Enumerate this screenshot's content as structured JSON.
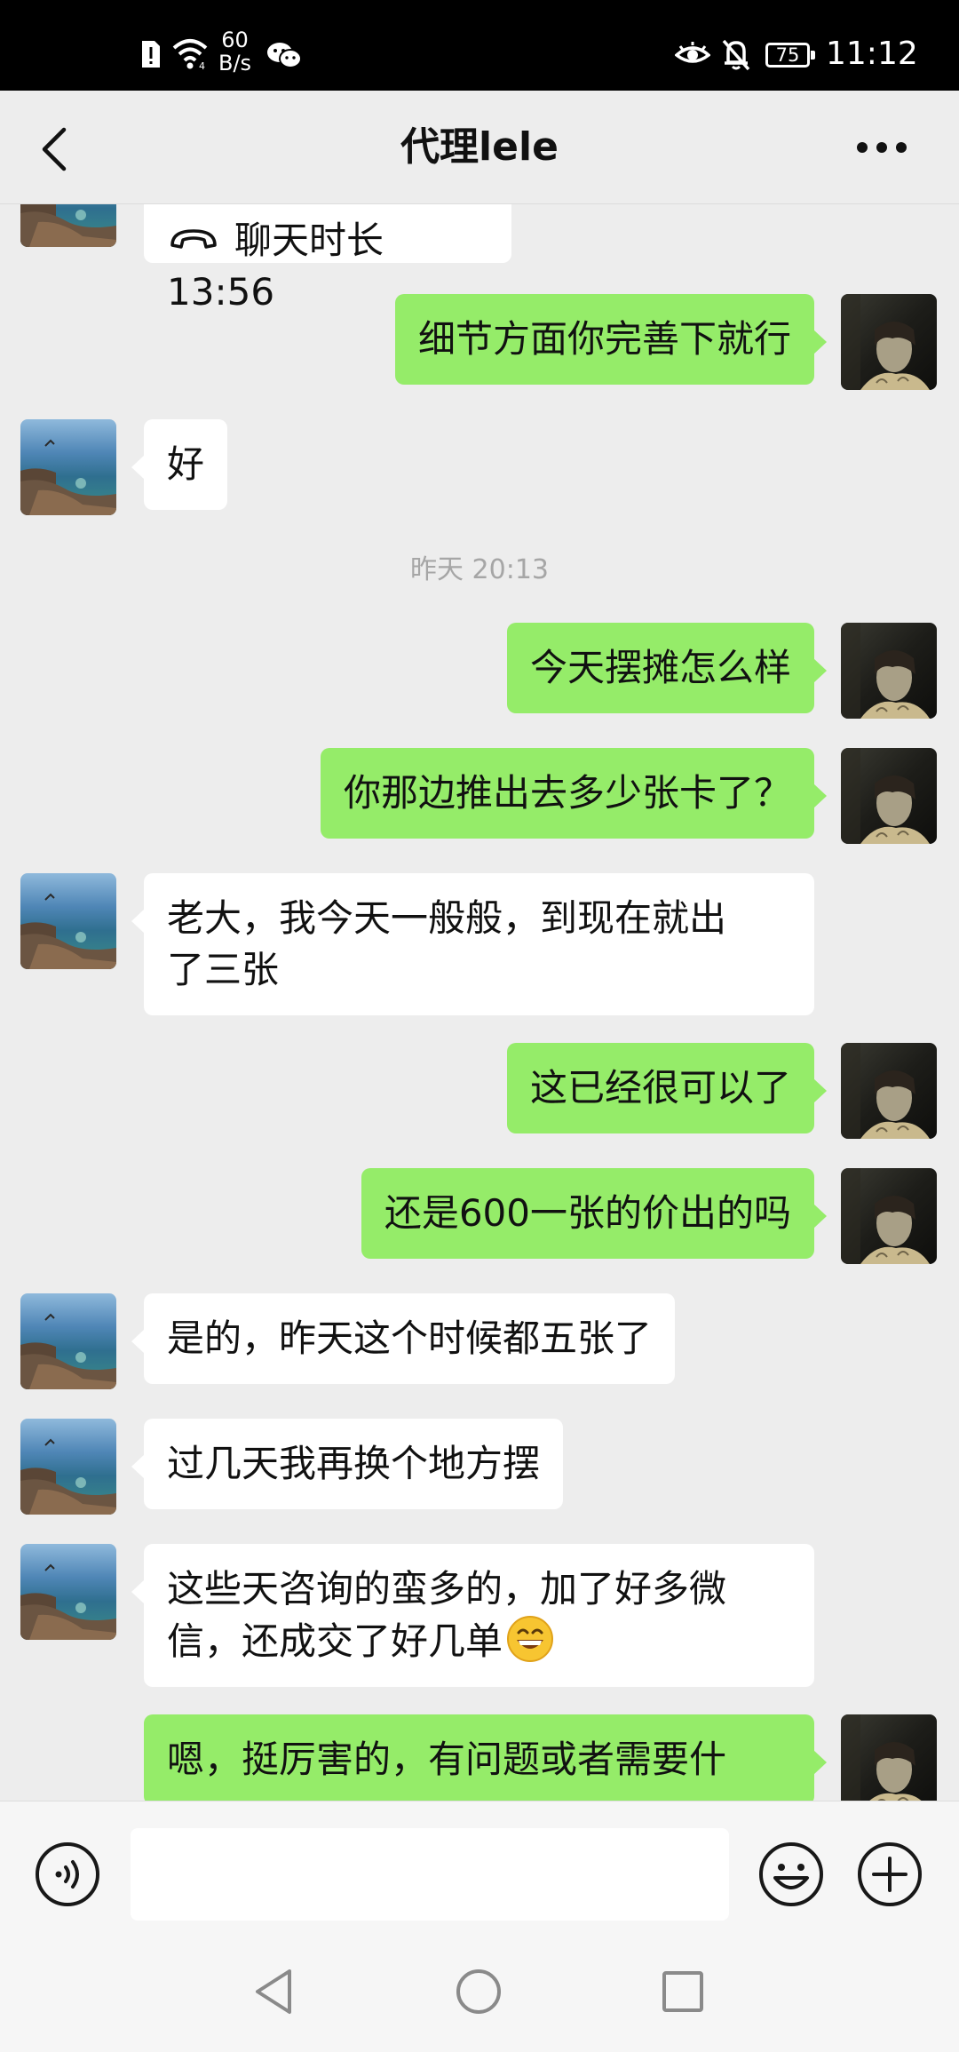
{
  "status_bar": {
    "net_speed_value": "60",
    "net_speed_unit": "B/s",
    "battery": "75",
    "time": "11:12",
    "icons": [
      "sim-alert-icon",
      "wifi-icon",
      "wechat-notification-icon",
      "eye-comfort-icon",
      "mute-bell-icon",
      "battery-icon"
    ]
  },
  "header": {
    "back_icon": "chevron-left-icon",
    "title": "代理lele",
    "more_icon": "more-dots-icon"
  },
  "messages": [
    {
      "side": "them",
      "type": "call",
      "icon": "phone-icon",
      "text": "聊天时长 13:56",
      "partial": true
    },
    {
      "side": "me",
      "text": "细节方面你完善下就行"
    },
    {
      "side": "them",
      "text": "好"
    },
    {
      "type": "timestamp",
      "text": "昨天 20:13"
    },
    {
      "side": "me",
      "text": "今天摆摊怎么样"
    },
    {
      "side": "me",
      "text": "你那边推出去多少张卡了？"
    },
    {
      "side": "them",
      "line1": "老大，我今天一般般，到现在就出",
      "line2": "了三张"
    },
    {
      "side": "me",
      "text": "这已经很可以了"
    },
    {
      "side": "me",
      "text": "还是600一张的价出的吗"
    },
    {
      "side": "them",
      "text": "是的，昨天这个时候都五张了"
    },
    {
      "side": "them",
      "text": "过几天我再换个地方摆"
    },
    {
      "side": "them",
      "line1": "这些天咨询的蛮多的，加了好多微",
      "line2": "信，还成交了好几单",
      "emoji": "grinning-face-emoji"
    },
    {
      "side": "me",
      "text": "嗯，挺厉害的，有问题或者需要什",
      "partial": true
    }
  ],
  "input_bar": {
    "voice_icon": "voice-input-icon",
    "placeholder": "",
    "emoji_icon": "emoji-smile-icon",
    "plus_icon": "plus-circle-icon"
  },
  "nav_bar": {
    "icons": [
      "nav-back-icon",
      "nav-home-icon",
      "nav-recents-icon"
    ]
  },
  "colors": {
    "status_bar_bg": "#000000",
    "chat_bg": "#ededed",
    "my_bubble": "#95ec69",
    "their_bubble": "#ffffff",
    "timestamp_text": "#a6a6a6"
  }
}
